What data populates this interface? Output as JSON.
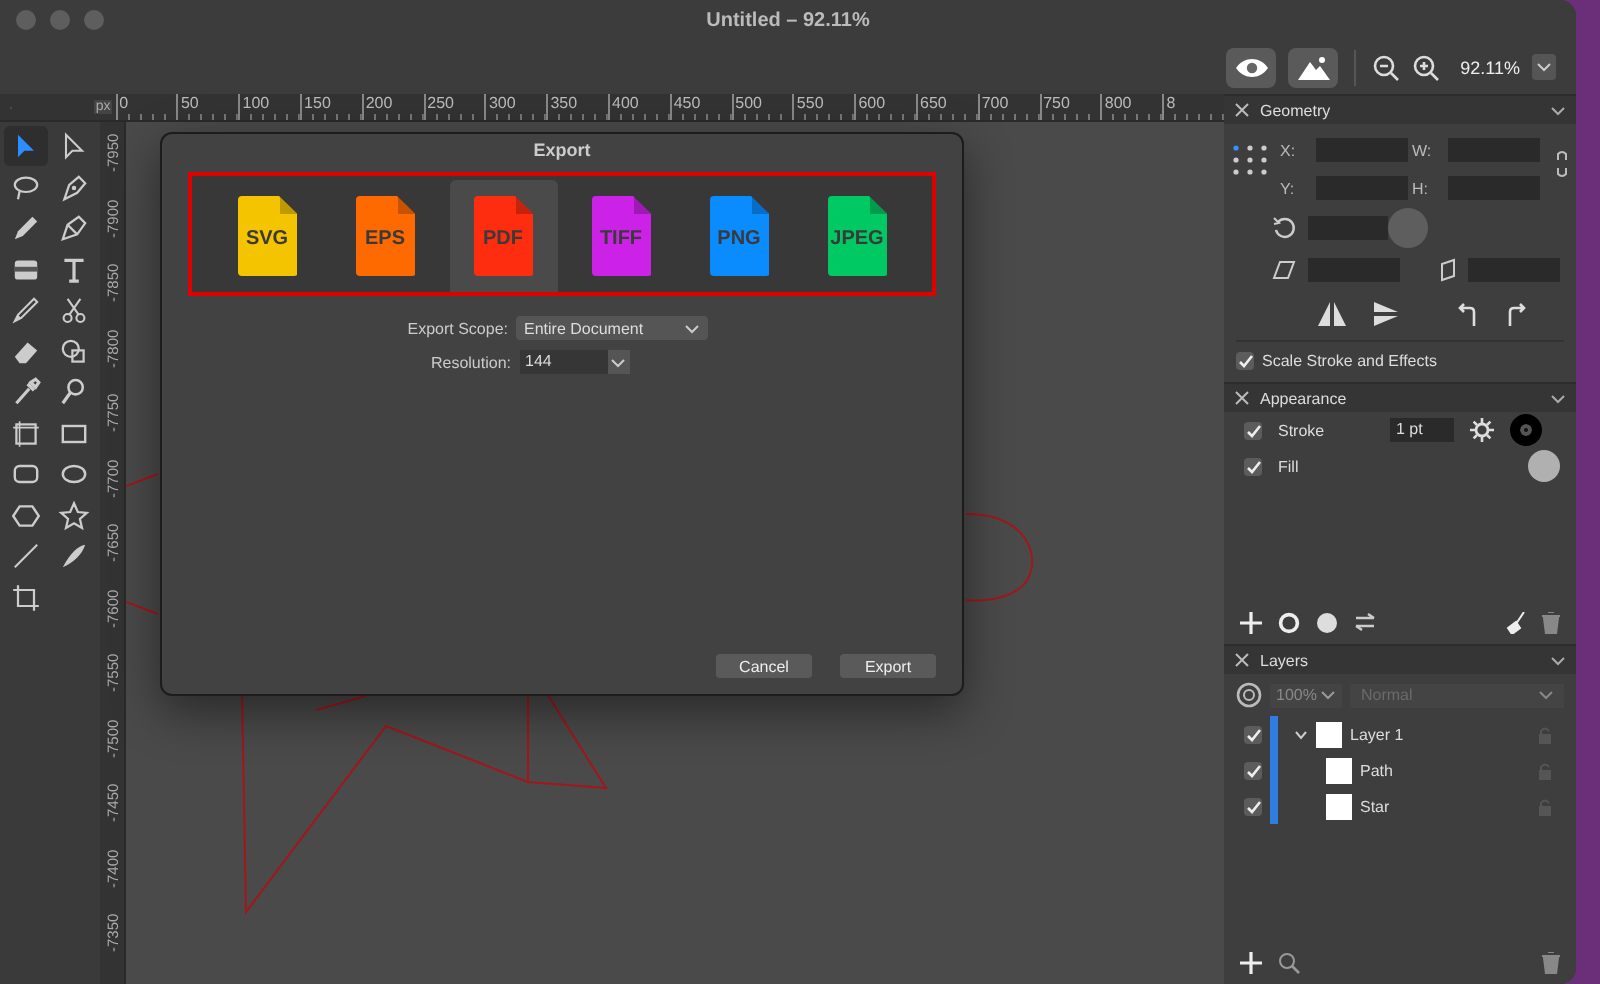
{
  "window": {
    "title": "Untitled – 92.11%"
  },
  "toolbar": {
    "zoom": "92.11%"
  },
  "ruler": {
    "unit": "px",
    "horizontal": [
      "0",
      "50",
      "100",
      "150",
      "200",
      "250",
      "300",
      "350",
      "400",
      "450",
      "500",
      "550",
      "600",
      "650",
      "700",
      "750",
      "800",
      "8"
    ],
    "vertical": [
      "-7950",
      "-7900",
      "-7850",
      "-7800",
      "-7750",
      "-7700",
      "-7650",
      "-7600",
      "-7550",
      "-7500",
      "-7450",
      "-7400",
      "-7350"
    ]
  },
  "tools": [
    {
      "kind": "arrow",
      "selected": true
    },
    {
      "kind": "hollowarrow",
      "selected": false
    },
    {
      "kind": "lasso",
      "selected": false
    },
    {
      "kind": "pen",
      "selected": false
    },
    {
      "kind": "pencil",
      "selected": false
    },
    {
      "kind": "nib",
      "selected": false
    },
    {
      "kind": "gradient",
      "selected": false
    },
    {
      "kind": "text",
      "selected": false
    },
    {
      "kind": "brush",
      "selected": false
    },
    {
      "kind": "scissors",
      "selected": false
    },
    {
      "kind": "eraser",
      "selected": false
    },
    {
      "kind": "builder",
      "selected": false
    },
    {
      "kind": "dropper",
      "selected": false
    },
    {
      "kind": "zoom",
      "selected": false
    },
    {
      "kind": "artboard",
      "selected": false
    },
    {
      "kind": "rect",
      "selected": false
    },
    {
      "kind": "roundrect",
      "selected": false
    },
    {
      "kind": "ellipse",
      "selected": false
    },
    {
      "kind": "polygon",
      "selected": false
    },
    {
      "kind": "star",
      "selected": false
    },
    {
      "kind": "line",
      "selected": false
    },
    {
      "kind": "blade",
      "selected": false
    },
    {
      "kind": "crop",
      "selected": false
    }
  ],
  "dialog": {
    "title": "Export",
    "formats": [
      {
        "label": "SVG",
        "color": "#f5c400",
        "selected": false
      },
      {
        "label": "EPS",
        "color": "#ff6a00",
        "selected": false
      },
      {
        "label": "PDF",
        "color": "#ff2d10",
        "selected": true
      },
      {
        "label": "TIFF",
        "color": "#cc22e8",
        "selected": false
      },
      {
        "label": "PNG",
        "color": "#0a8cff",
        "selected": false
      },
      {
        "label": "JPEG",
        "color": "#00c862",
        "selected": false
      }
    ],
    "scope": {
      "label": "Export Scope:",
      "value": "Entire Document"
    },
    "resolution": {
      "label": "Resolution:",
      "value": "144"
    },
    "buttons": [
      "Cancel",
      "Export"
    ]
  },
  "geometry": {
    "title": "Geometry",
    "fields": [
      "X:",
      "W:",
      "Y:",
      "H:"
    ],
    "scale_stroke": {
      "label": "Scale Stroke and Effects",
      "checked": true
    }
  },
  "appearance": {
    "title": "Appearance",
    "rows": [
      {
        "kind": "stroke",
        "label": "Stroke",
        "checked": true,
        "value": "1 pt"
      },
      {
        "kind": "fill",
        "label": "Fill",
        "checked": true
      }
    ]
  },
  "layers": {
    "title": "Layers",
    "opacity": "100%",
    "blend": {
      "value": "Normal",
      "disabled": true
    },
    "items": [
      {
        "name": "Layer 1",
        "visible": true,
        "expanded": true,
        "children": [
          {
            "name": "Path",
            "visible": true
          },
          {
            "name": "Star",
            "visible": true
          }
        ]
      }
    ]
  }
}
